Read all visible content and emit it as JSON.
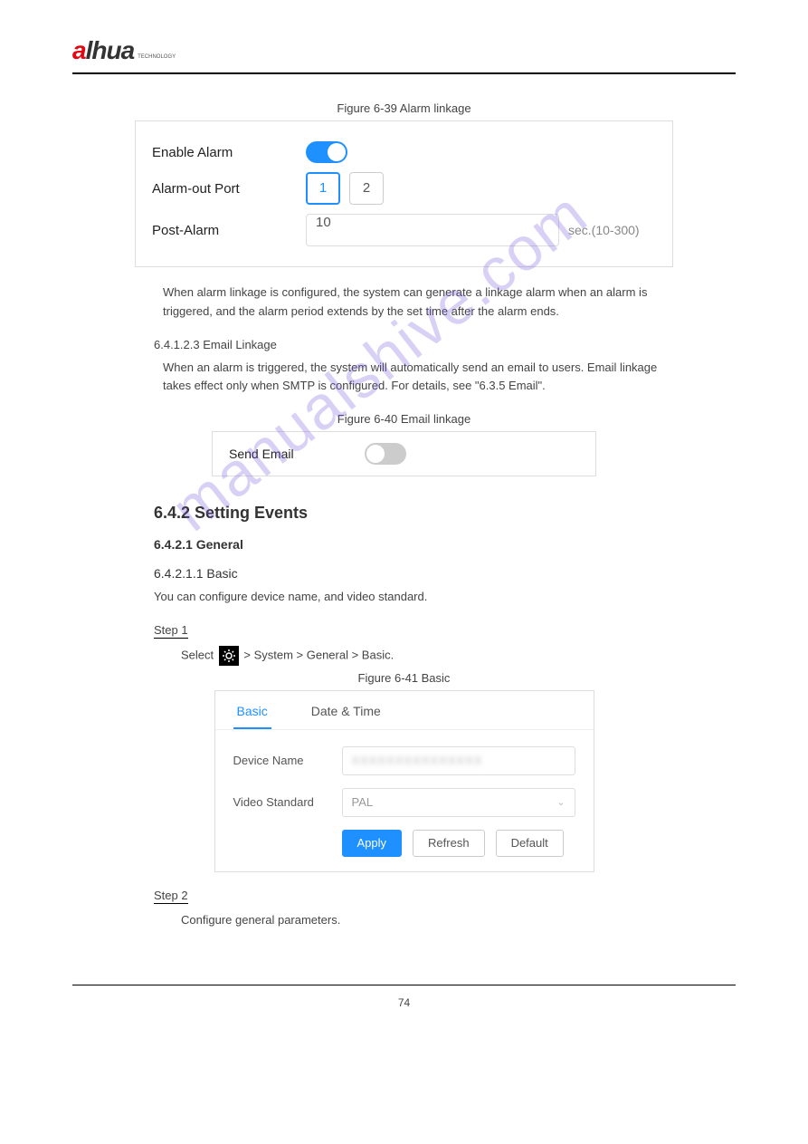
{
  "logo": {
    "brand_a": "a",
    "brand_hua": "lhua",
    "sub": "TECHNOLOGY"
  },
  "watermark": "manualshive.com",
  "figure1": {
    "caption": "Figure 6-39 Alarm linkage",
    "enable_label": "Enable Alarm",
    "port_label": "Alarm-out Port",
    "port_1": "1",
    "port_2": "2",
    "post_label": "Post-Alarm",
    "post_value": "10",
    "post_suffix": "sec.(10-300)"
  },
  "section_alarm": {
    "desc": "When alarm linkage is configured, the system can generate a linkage alarm when an alarm is triggered, and the alarm period extends by the set time after the alarm ends.",
    "h1": "6.4.1.2.3 Email Linkage",
    "body": "When an alarm is triggered, the system will automatically send an email to users. Email linkage takes effect only when SMTP is configured. For details, see \"6.3.5 Email\"."
  },
  "figure2": {
    "caption": "Figure 6-40 Email linkage",
    "label": "Send Email"
  },
  "section_events": {
    "title": "6.4.2 Setting Events",
    "sub_title": "6.4.2.1 General",
    "sub_sub": "6.4.2.1.1 Basic",
    "desc": "You can configure device name, and video standard.",
    "step1_label": "Step 1",
    "step1_text_a": "Select ",
    "step1_text_b": " > System > General > Basic.",
    "fig_caption": "Figure 6-41 Basic",
    "tab_basic": "Basic",
    "tab_date": "Date & Time",
    "device_name_label": "Device Name",
    "device_name_value": "XXXXXXXXXXXXXXX",
    "video_std_label": "Video Standard",
    "video_std_value": "PAL",
    "btn_apply": "Apply",
    "btn_refresh": "Refresh",
    "btn_default": "Default",
    "step2_label": "Step 2",
    "step2_text": "Configure general parameters."
  },
  "page_number": "74"
}
